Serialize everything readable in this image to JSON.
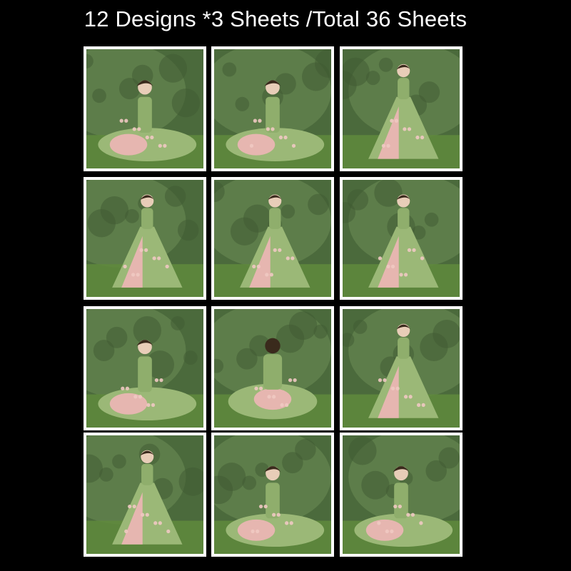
{
  "header": {
    "title": "12 Designs *3 Sheets /Total 36 Sheets"
  },
  "palette": {
    "background": "#000000",
    "frame": "#ffffff",
    "dress_green": "#9bb877",
    "dress_pink": "#e6b6b0",
    "backdrop_green": "#4b6a3c",
    "grass": "#5f8a3c"
  },
  "sheets": [
    {
      "icon": "lady-seated-floral-gown-icon",
      "pose": "seated"
    },
    {
      "icon": "lady-seated-floral-gown-icon",
      "pose": "seated"
    },
    {
      "icon": "lady-standing-floral-gown-icon",
      "pose": "standing"
    },
    {
      "icon": "lady-standing-floral-gown-icon",
      "pose": "standing"
    },
    {
      "icon": "lady-standing-floral-gown-icon",
      "pose": "standing"
    },
    {
      "icon": "lady-standing-floral-gown-icon",
      "pose": "standing"
    },
    {
      "icon": "lady-seated-floral-gown-icon",
      "pose": "seated"
    },
    {
      "icon": "lady-seated-back-view-gown-icon",
      "pose": "back"
    },
    {
      "icon": "lady-standing-floral-gown-icon",
      "pose": "standing"
    },
    {
      "icon": "lady-standing-floral-gown-icon",
      "pose": "standing"
    },
    {
      "icon": "lady-seated-floral-gown-icon",
      "pose": "seated"
    },
    {
      "icon": "lady-seated-floral-gown-icon",
      "pose": "seated"
    }
  ]
}
